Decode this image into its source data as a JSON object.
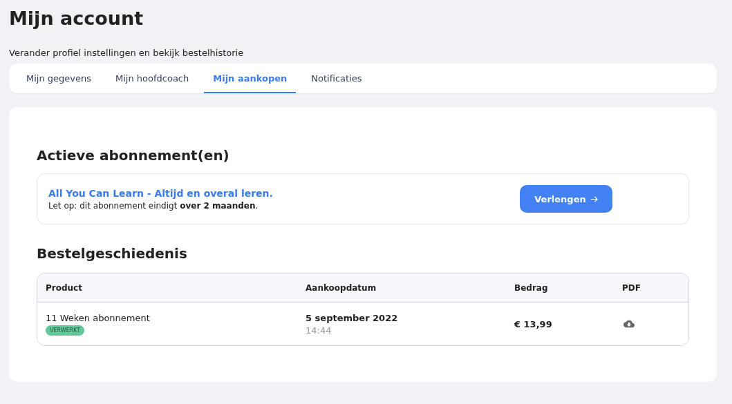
{
  "page": {
    "title": "Mijn account",
    "subtitle": "Verander profiel instellingen en bekijk bestelhistorie"
  },
  "tabs": [
    {
      "label": "Mijn gegevens",
      "selected": false
    },
    {
      "label": "Mijn hoofdcoach",
      "selected": false
    },
    {
      "label": "Mijn aankopen",
      "selected": true
    },
    {
      "label": "Notificaties",
      "selected": false
    }
  ],
  "subscriptions": {
    "heading": "Actieve abonnement(en)",
    "items": [
      {
        "name": "All You Can Learn - Altijd en overal leren.",
        "note": "Let op: dit abonnement eindigt **over 2 maanden**.",
        "button": "Verlengen"
      }
    ]
  },
  "orders": {
    "heading": "Bestelgeschiedenis",
    "columns": [
      "Product",
      "Aankoopdatum",
      "Bedrag",
      "PDF"
    ],
    "rows": [
      {
        "product": "11 Weken abonnement",
        "status": "VERWERKT",
        "date": "5 september 2022",
        "time": "14:44",
        "amount": "€ 13,99"
      }
    ]
  }
}
